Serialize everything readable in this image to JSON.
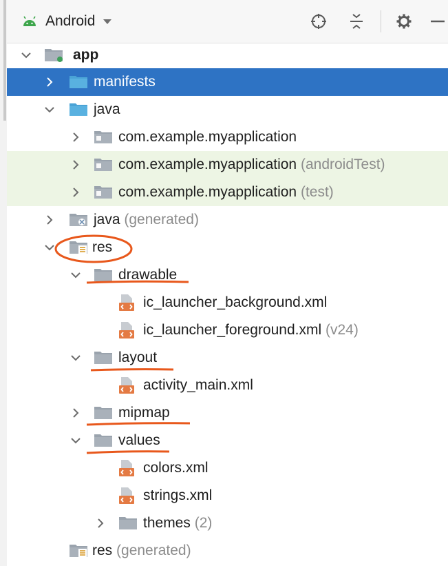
{
  "toolbar": {
    "view_label": "Android",
    "icons": [
      "locate-icon",
      "collapse-all-icon",
      "settings-gear-icon",
      "hide-icon"
    ]
  },
  "colors": {
    "selection": "#2e73c4",
    "test_highlight": "#edf5e4",
    "annotation": "#e8581c",
    "folder_gray": "#9aa3ad",
    "folder_blue": "#59b1e0",
    "xml_orange": "#e47a43"
  },
  "tree": {
    "app": "app",
    "manifests": "manifests",
    "java": "java",
    "pkg_main": "com.example.myapplication",
    "pkg_android_test": "com.example.myapplication",
    "pkg_android_test_suffix": "(androidTest)",
    "pkg_test": "com.example.myapplication",
    "pkg_test_suffix": "(test)",
    "java_gen": "java",
    "java_gen_suffix": "(generated)",
    "res": "res",
    "drawable": "drawable",
    "ic_bg": "ic_launcher_background.xml",
    "ic_fg": "ic_launcher_foreground.xml",
    "ic_fg_suffix": "(v24)",
    "layout": "layout",
    "activity_main": "activity_main.xml",
    "mipmap": "mipmap",
    "values": "values",
    "colors_xml": "colors.xml",
    "strings_xml": "strings.xml",
    "themes": "themes",
    "themes_suffix": "(2)",
    "res_gen": "res",
    "res_gen_suffix": "(generated)"
  }
}
